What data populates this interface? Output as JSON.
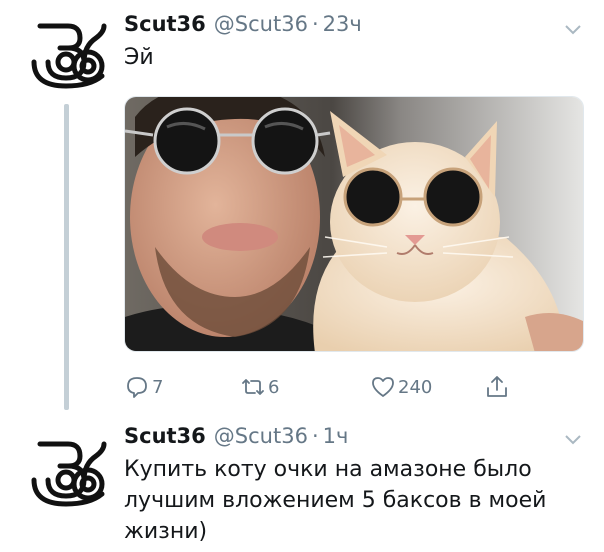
{
  "tweets": [
    {
      "display_name": "Scut36",
      "handle": "@Scut36",
      "separator": "·",
      "time": "23ч",
      "text": "Эй",
      "avatar_icon": "scut36-logo-icon",
      "media": {
        "description_icon": "photo-man-and-cat-in-sunglasses"
      },
      "actions": {
        "reply_count": "7",
        "retweet_count": "6",
        "like_count": "240"
      }
    },
    {
      "display_name": "Scut36",
      "handle": "@Scut36",
      "separator": "·",
      "time": "1ч",
      "text": "Купить коту очки на амазоне было лучшим вложением 5 баксов в моей жизни)",
      "avatar_icon": "scut36-logo-icon"
    }
  ],
  "colors": {
    "text": "#14171a",
    "secondary": "#657786",
    "thread_line": "#c4cfd6"
  }
}
